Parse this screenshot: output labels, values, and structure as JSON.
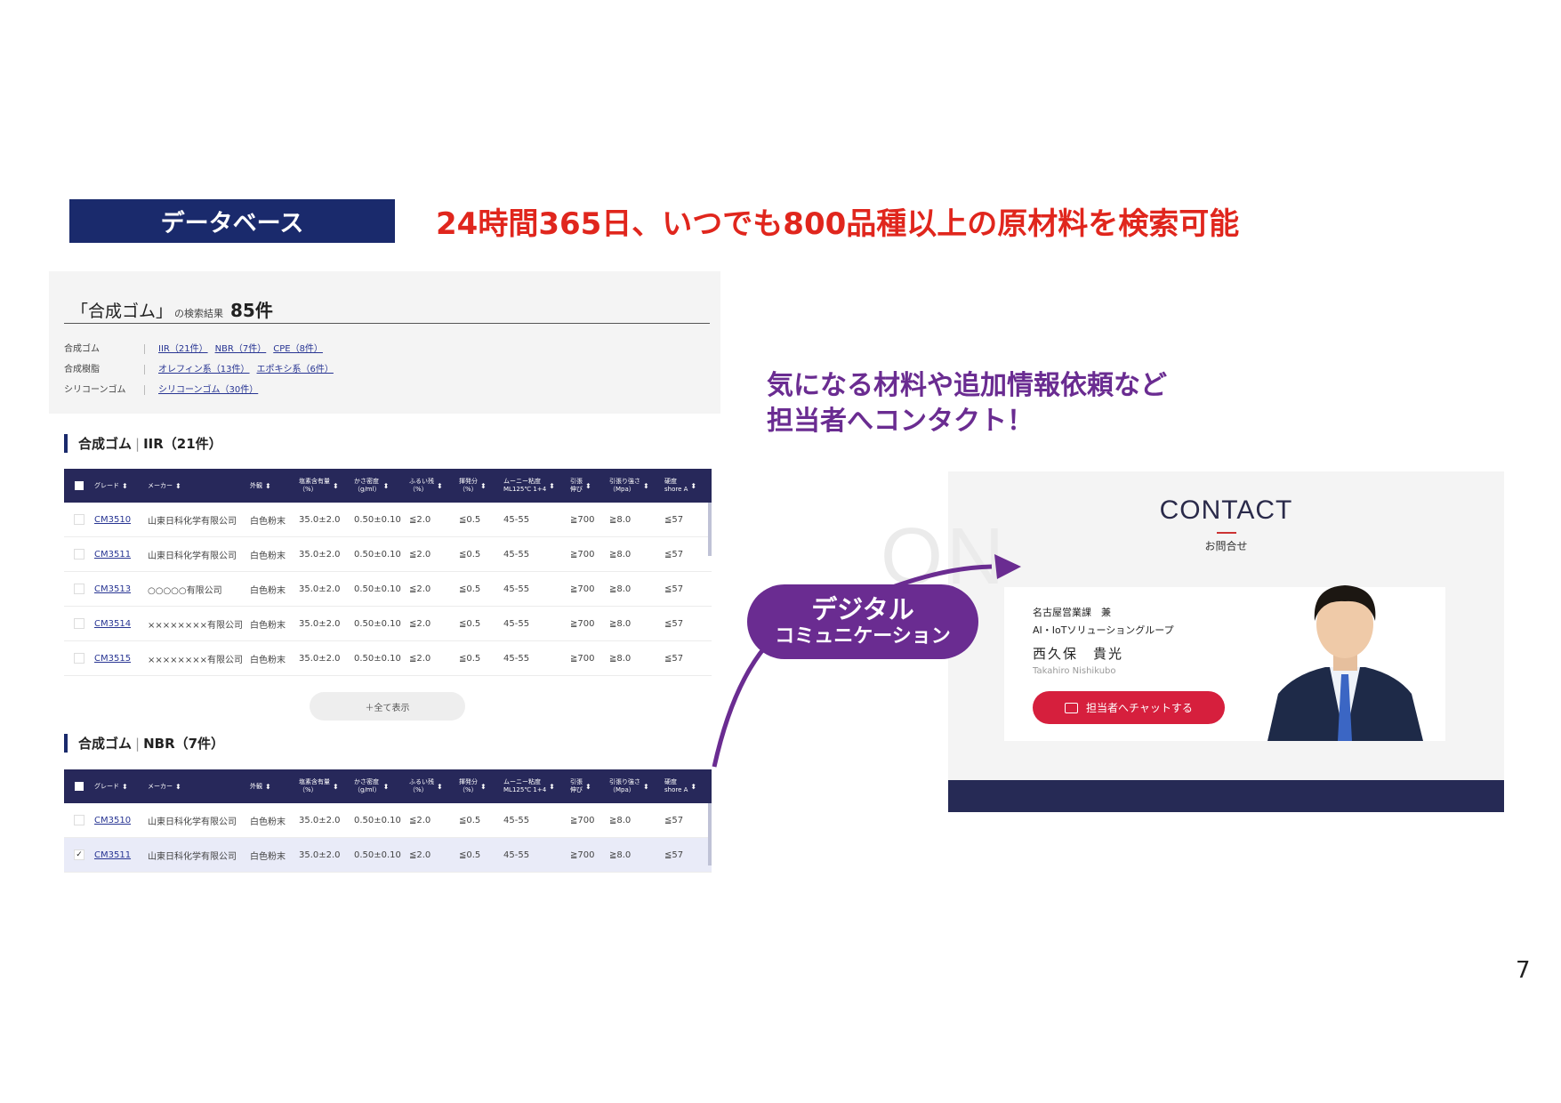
{
  "header": {
    "badge": "データベース",
    "headline": "24時間365日、いつでも800品種以上の原材料を検索可能"
  },
  "search": {
    "query": "「合成ゴム」",
    "suffix": "の検索結果",
    "count": "85件",
    "categories": [
      {
        "label": "合成ゴム",
        "links": [
          "IIR（21件）",
          "NBR（7件）",
          "CPE（8件）"
        ]
      },
      {
        "label": "合成樹脂",
        "links": [
          "オレフィン系（13件）",
          "エポキシ系（6件）"
        ]
      },
      {
        "label": "シリコーンゴム",
        "links": [
          "シリコーンゴム（30件）"
        ]
      }
    ]
  },
  "table_headers": [
    {
      "l1": "グレード",
      "l2": ""
    },
    {
      "l1": "メーカー",
      "l2": ""
    },
    {
      "l1": "外観",
      "l2": ""
    },
    {
      "l1": "塩素含有量",
      "l2": "（%）"
    },
    {
      "l1": "かさ密度",
      "l2": "（g/ml）"
    },
    {
      "l1": "ふるい残",
      "l2": "（%）"
    },
    {
      "l1": "揮発分",
      "l2": "（%）"
    },
    {
      "l1": "ムーニー粘度",
      "l2": "ML125℃ 1+4"
    },
    {
      "l1": "引張",
      "l2": "伸び"
    },
    {
      "l1": "引張り強さ",
      "l2": "（Mpa）"
    },
    {
      "l1": "硬度",
      "l2": "shore A"
    }
  ],
  "sections": [
    {
      "title_main": "合成ゴム",
      "title_sub": "IIR（21件）",
      "rows": [
        {
          "checked": "",
          "cells": [
            "CM3510",
            "山東日科化学有限公司",
            "白色粉末",
            "35.0±2.0",
            "0.50±0.10",
            "≦2.0",
            "≦0.5",
            "45-55",
            "≧700",
            "≧8.0",
            "≦57"
          ]
        },
        {
          "checked": "",
          "cells": [
            "CM3511",
            "山東日科化学有限公司",
            "白色粉末",
            "35.0±2.0",
            "0.50±0.10",
            "≦2.0",
            "≦0.5",
            "45-55",
            "≧700",
            "≧8.0",
            "≦57"
          ]
        },
        {
          "checked": "",
          "cells": [
            "CM3513",
            "○○○○○有限公司",
            "白色粉末",
            "35.0±2.0",
            "0.50±0.10",
            "≦2.0",
            "≦0.5",
            "45-55",
            "≧700",
            "≧8.0",
            "≦57"
          ]
        },
        {
          "checked": "",
          "cells": [
            "CM3514",
            "××××××××有限公司",
            "白色粉末",
            "35.0±2.0",
            "0.50±0.10",
            "≦2.0",
            "≦0.5",
            "45-55",
            "≧700",
            "≧8.0",
            "≦57"
          ]
        },
        {
          "checked": "",
          "cells": [
            "CM3515",
            "××××××××有限公司",
            "白色粉末",
            "35.0±2.0",
            "0.50±0.10",
            "≦2.0",
            "≦0.5",
            "45-55",
            "≧700",
            "≧8.0",
            "≦57"
          ]
        }
      ]
    },
    {
      "title_main": "合成ゴム",
      "title_sub": "NBR（7件）",
      "rows": [
        {
          "checked": "",
          "cells": [
            "CM3510",
            "山東日科化学有限公司",
            "白色粉末",
            "35.0±2.0",
            "0.50±0.10",
            "≦2.0",
            "≦0.5",
            "45-55",
            "≧700",
            "≧8.0",
            "≦57"
          ]
        },
        {
          "checked": "✓",
          "cells": [
            "CM3511",
            "山東日科化学有限公司",
            "白色粉末",
            "35.0±2.0",
            "0.50±0.10",
            "≦2.0",
            "≦0.5",
            "45-55",
            "≧700",
            "≧8.0",
            "≦57"
          ]
        }
      ]
    }
  ],
  "show_all_label": "＋全て表示",
  "contact_message": {
    "line1": "気になる材料や追加情報依頼など",
    "line2": "担当者へコンタクト！"
  },
  "contact": {
    "watermark": "ON",
    "heading": "CONTACT",
    "sub": "お問合せ",
    "dept1": "名古屋営業課　兼",
    "dept2": "AI・IoTソリューショングループ",
    "name": "西久保　貴光",
    "name_en": "Takahiro Nishikubo",
    "chat_button": "担当者へチャットする"
  },
  "pill": {
    "line1": "デジタル",
    "line2": "コミュニケーション"
  },
  "colors": {
    "navy": "#1a2a6c",
    "headline_red": "#e0261d",
    "purple": "#6a2c91",
    "button_red": "#d61f3d"
  },
  "page_number": "7"
}
